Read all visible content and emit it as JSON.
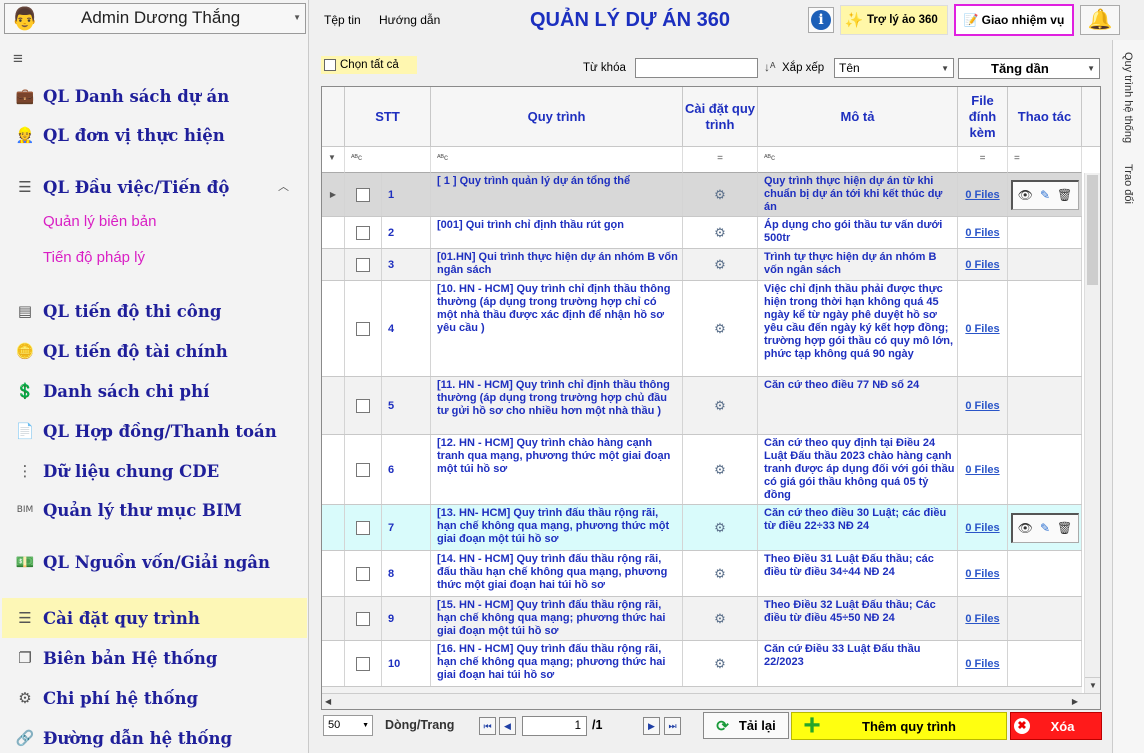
{
  "user": {
    "name": "Admin Dương Thắng"
  },
  "menu": {
    "file": "Tệp tin",
    "help": "Hướng dẫn"
  },
  "app_title": "QUẢN LÝ DỰ ÁN 360",
  "header_buttons": {
    "assistant": "Trợ lý ảo 360",
    "assign_task": "Giao nhiệm vụ"
  },
  "sidebar": {
    "items": [
      {
        "label": "QL Danh sách dự án",
        "icon": "briefcase-icon"
      },
      {
        "label": "QL đơn vị thực hiện",
        "icon": "worker-icon"
      },
      {
        "label": "QL Đầu việc/Tiến độ",
        "icon": "task-list-icon"
      },
      {
        "label": "QL tiến độ thi công",
        "icon": "gantt-icon"
      },
      {
        "label": "QL tiến độ tài chính",
        "icon": "coins-icon"
      },
      {
        "label": "Danh sách chi phí",
        "icon": "dollar-icon"
      },
      {
        "label": "QL Hợp đồng/Thanh toán",
        "icon": "contract-icon"
      },
      {
        "label": "Dữ liệu chung CDE",
        "icon": "data-tree-icon"
      },
      {
        "label": "Quản lý thư mục BIM",
        "icon": "bim-icon"
      },
      {
        "label": "QL Nguồn vốn/Giải ngân",
        "icon": "cash-icon"
      },
      {
        "label": "Cài đặt quy trình",
        "icon": "list-settings-icon"
      },
      {
        "label": "Biên bản Hệ thống",
        "icon": "copy-docs-icon"
      },
      {
        "label": "Chi phí hệ thống",
        "icon": "cost-settings-icon"
      },
      {
        "label": "Đường dẫn hệ thống",
        "icon": "link-icon"
      }
    ],
    "subitems": [
      "Quản lý biên bản",
      "Tiến độ pháp lý"
    ]
  },
  "toolbar": {
    "select_all": "Chọn tất cả",
    "keyword_label": "Từ khóa",
    "keyword_value": "",
    "sort_label": "Xắp xếp",
    "sort_field": "Tên",
    "sort_order": "Tăng dần"
  },
  "right_tabs": [
    "Quy trình hệ thống",
    "Trao đổi"
  ],
  "table": {
    "columns": [
      "STT",
      "Quy trình",
      "Cài đặt quy trình",
      "Mô tả",
      "File đính kèm",
      "Thao tác"
    ],
    "rows": [
      {
        "stt": "1",
        "process": "[ 1 ] Quy trình quản lý dự án tổng thể",
        "desc": "Quy trình thực hiện dự án từ khi chuẩn bị dự án tới khi kết thúc dự án",
        "files": "0 Files"
      },
      {
        "stt": "2",
        "process": "[001] Qui trình chỉ định thầu rút gọn",
        "desc": "Áp dụng cho gói thầu tư vấn dưới 500tr",
        "files": "0 Files"
      },
      {
        "stt": "3",
        "process": "[01.HN] Qui trình thực hiện dự án nhóm B vốn ngân sách",
        "desc": "Trình tự thực hiện dự án nhóm B vốn ngân sách",
        "files": "0 Files"
      },
      {
        "stt": "4",
        "process": "[10. HN - HCM] Quy trình chỉ định thầu thông thường (áp dụng trong trường hợp chỉ có một nhà thầu được xác định để nhận hồ sơ yêu cầu )",
        "desc": "Việc chỉ định thầu phải được thực hiện trong thời hạn không quá 45 ngày kể từ ngày phê duyệt hồ sơ yêu cầu đến ngày ký kết hợp đồng; trường hợp gói thầu có quy mô lớn, phức tạp không quá 90 ngày",
        "files": "0 Files"
      },
      {
        "stt": "5",
        "process": "[11. HN - HCM] Quy trình chỉ định thầu thông thường (áp dụng trong trường hợp chủ đầu tư gửi hồ sơ cho nhiều hơn một nhà thầu )",
        "desc": "Căn cứ theo điều 77 NĐ số 24",
        "files": "0 Files"
      },
      {
        "stt": "6",
        "process": "[12. HN - HCM] Quy trình chào hàng cạnh tranh qua mạng, phương thức một giai đoạn một túi hồ sơ",
        "desc": "Căn cứ theo quy định tại Điều 24 Luật Đấu thầu 2023  chào hàng cạnh tranh được áp dụng đối với gói thầu có giá gói thầu không quá 05 tỷ đồng",
        "files": "0 Files"
      },
      {
        "stt": "7",
        "process": "[13. HN- HCM] Quy trình đấu thầu rộng rãi, hạn chế không qua mạng, phương thức một giai đoạn một túi hồ sơ",
        "desc": "Căn cứ theo điều 30 Luật; các điều từ điều 22÷33 NĐ 24",
        "files": "0 Files"
      },
      {
        "stt": "8",
        "process": "[14. HN - HCM] Quy trình đấu thầu rộng rãi, đấu thầu hạn chế không qua mạng, phương thức một giai đoạn hai túi hồ sơ",
        "desc": "Theo Điều 31 Luật Đấu thầu; các điều từ điều 34÷44 NĐ 24",
        "files": "0 Files"
      },
      {
        "stt": "9",
        "process": "[15. HN - HCM] Quy trình đấu thầu rộng rãi, hạn chế không qua mạng; phương thức hai giai đoạn một túi hồ sơ",
        "desc": "Theo Điều 32 Luật Đấu thầu; Các điều từ điều 45÷50 NĐ 24",
        "files": "0 Files"
      },
      {
        "stt": "10",
        "process": "[16. HN - HCM] Quy trình đấu thầu rộng rãi, hạn chế không qua mạng; phương thức hai giai đoạn hai túi hồ sơ",
        "desc": "Căn cứ Điều 33 Luật Đấu thầu 22/2023",
        "files": "0 Files"
      }
    ]
  },
  "footer": {
    "page_size": "50",
    "rows_per_page_label": "Dòng/Trang",
    "page_current": "1",
    "page_total": "/1",
    "reload": "Tải lại",
    "add": "Thêm quy trình",
    "delete": "Xóa"
  },
  "colors": {
    "title": "#1b2fbf",
    "nav": "#1f1f9a",
    "sub": "#d91fc4",
    "add_bg": "#ffff10",
    "delete_bg": "#ff1a1a",
    "selected_row": "#d9fbfb"
  }
}
